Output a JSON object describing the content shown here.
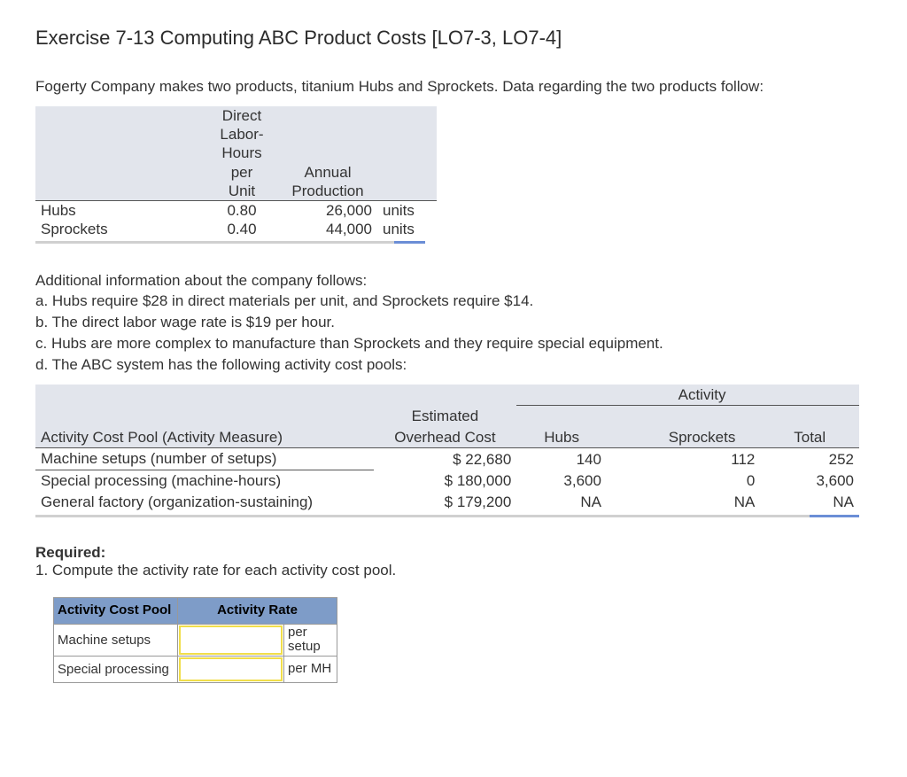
{
  "title": "Exercise 7-13 Computing ABC Product Costs [LO7-3, LO7-4]",
  "intro": "Fogerty Company makes two products, titanium Hubs and Sprockets. Data regarding the two products follow:",
  "table1": {
    "head": {
      "dlh_l1": "Direct",
      "dlh_l2": "Labor-",
      "dlh_l3": "Hours",
      "dlh_l4": "per",
      "dlh_l5": "Unit",
      "prod_l1": "Annual",
      "prod_l2": "Production"
    },
    "rows": [
      {
        "name": "Hubs",
        "dlh": "0.80",
        "prod": "26,000",
        "units": "units"
      },
      {
        "name": "Sprockets",
        "dlh": "0.40",
        "prod": "44,000",
        "units": "units"
      }
    ]
  },
  "info": {
    "lead": "Additional information about the company follows:",
    "a": "a. Hubs require $28 in direct materials per unit, and Sprockets require $14.",
    "b": "b. The direct labor wage rate is $19 per hour.",
    "c": "c. Hubs are more complex to manufacture than Sprockets and they require special equipment.",
    "d": "d. The ABC system has the following activity cost pools:"
  },
  "table2": {
    "activity_label": "Activity",
    "head": {
      "pool": "Activity Cost Pool (Activity Measure)",
      "cost_l1": "Estimated",
      "cost_l2": "Overhead Cost",
      "hubs": "Hubs",
      "sprockets": "Sprockets",
      "total": "Total"
    },
    "rows": [
      {
        "pool": "Machine setups (number of setups)",
        "cost": "$  22,680",
        "hubs": "140",
        "spr": "112",
        "tot": "252"
      },
      {
        "pool": "Special processing (machine-hours)",
        "cost": "$ 180,000",
        "hubs": "3,600",
        "spr": "0",
        "tot": "3,600"
      },
      {
        "pool": "General factory (organization-sustaining)",
        "cost": "$ 179,200",
        "hubs": "NA",
        "spr": "NA",
        "tot": "NA"
      }
    ]
  },
  "required": {
    "label": "Required:",
    "q1": "1.  Compute the activity rate for each activity cost pool."
  },
  "table3": {
    "h1": "Activity Cost Pool",
    "h2": "Activity Rate",
    "rows": [
      {
        "name": "Machine setups",
        "unit": "per setup"
      },
      {
        "name": "Special processing",
        "unit": "per MH"
      }
    ]
  }
}
